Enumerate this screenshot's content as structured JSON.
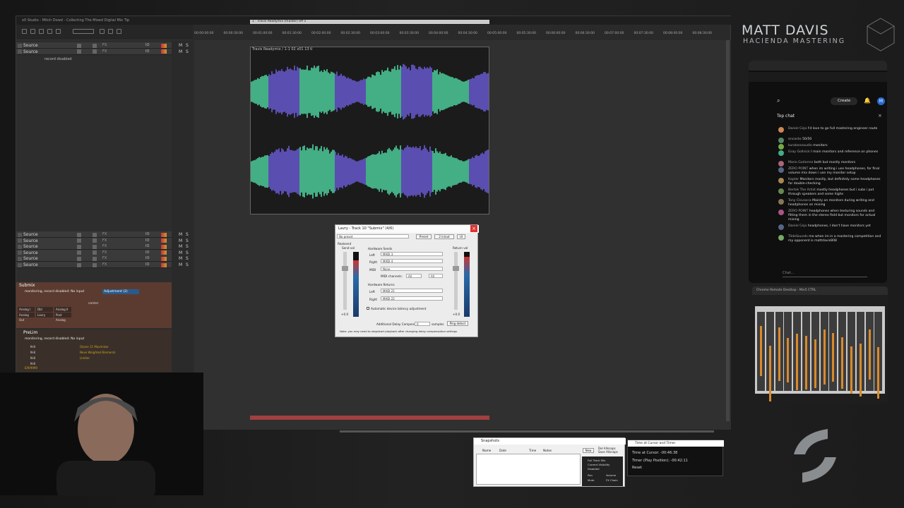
{
  "daw": {
    "window_title": "x0 Studio - Mitch Dowd - Collecting The Mixed Digital Mix Tip",
    "tracks_top": [
      {
        "name": "Source",
        "fx": "FX",
        "io": "IO"
      },
      {
        "name": "Source",
        "fx": "FX",
        "io": "IO"
      }
    ],
    "record_status_top": "record disabled",
    "tracks_mid": [
      {
        "name": "Source",
        "fx": "FX",
        "io": "IO"
      },
      {
        "name": "Source",
        "fx": "FX",
        "io": "IO"
      },
      {
        "name": "Source",
        "fx": "FX",
        "io": "IO"
      },
      {
        "name": "Source",
        "fx": "FX",
        "io": "IO"
      },
      {
        "name": "Source",
        "fx": "FX",
        "io": "IO"
      },
      {
        "name": "Source",
        "fx": "FX",
        "io": "IO"
      }
    ],
    "submix": {
      "name": "Submix",
      "status": "monitoring, record disabled: No input",
      "plugin": "Adjustment (2)",
      "sends": [
        "Analog I",
        "Dbl",
        "Analog II",
        "Analog Out",
        "Lavry",
        "Post Analog"
      ],
      "center": "center"
    },
    "prelim": {
      "name": "PreLim",
      "status": "monitoring, record disabled: No input",
      "inserts": [
        "Ozone 11 Maximizer",
        "Neve Weighted Elements",
        "Limiter"
      ],
      "nodes": [
        "N-8",
        "N-8",
        "N-8",
        "N-8"
      ],
      "cpu": "E/9/9999"
    },
    "item_label": "Travis Readymix / 1-1 02 x01 13 tl",
    "item_selection": "1 - Travis Readymix (master) eff 1",
    "ruler": [
      "00:00:00:00",
      "00:00:30:00",
      "00:01:00:00",
      "00:01:30:00",
      "00:02:00:00",
      "00:02:30:00",
      "00:03:00:00",
      "00:03:30:00",
      "00:04:00:00",
      "00:04:30:00",
      "00:05:00:00",
      "00:05:30:00",
      "00:06:00:00",
      "00:06:30:00",
      "00:07:00:00",
      "00:07:30:00",
      "00:08:00:00",
      "00:08:30:00"
    ],
    "mute_label": "M",
    "solo_label": "S"
  },
  "routing_dialog": {
    "title": "Lavry - Track 10 \"Submix\" (4/6)",
    "preset": "No preset",
    "preset_button": "Preset",
    "in_out": "2 in/out",
    "ui_button": "UI",
    "realsend": "Realsend",
    "send_vol": "Send vol",
    "return_vol": "Return vol",
    "hardware_sends": "Hardware Sends",
    "left": "Left",
    "right": "Right",
    "midi": "MIDI",
    "send_left": "MADI 3",
    "send_right": "MADI 4",
    "midi_value": "None",
    "midi_channels": "MIDI channels:",
    "all1": "All",
    "all2": "All",
    "hardware_returns": "Hardware Returns",
    "ret_left": "MADI 21",
    "ret_right": "MADI 22",
    "auto_latency": "Automatic device latency adjustment",
    "additional_delay": "Additional Delay Compensation:",
    "delay_value": "0",
    "samples": "samples",
    "ping_detect": "Ping detect",
    "note": "Note: you may need to stop/start playback after changing delay compensation settings",
    "send_db": "+0.0",
    "return_db": "+0.0"
  },
  "branding": {
    "line1": "MATT DAVIS",
    "line2": "HACIENDA MASTERING"
  },
  "chat": {
    "create_button": "Create",
    "header": "Top chat",
    "avatar_letter": "M",
    "input_placeholder": "Chat...",
    "messages": [
      {
        "user": "Daniel Ceja",
        "text": "I'd love to go full mastering engineer route"
      },
      {
        "user": "encanto",
        "text": "50/50"
      },
      {
        "user": "kurokonoaudio",
        "text": "monitors"
      },
      {
        "user": "Gray Gollnick",
        "text": "I main monitors and reference on phones"
      },
      {
        "user": "Mario Gutierrez",
        "text": "both but mostly monitors"
      },
      {
        "user": "ZERO POINT",
        "text": "when im writing i use headphones, for final volume mix down i use my monitor setup"
      },
      {
        "user": "Kapter",
        "text": "Monitors mostly, but definitely some headphones for double-checking"
      },
      {
        "user": "Bertok The Artist",
        "text": "mostly headphones but i subs i put through speakers and some highs"
      },
      {
        "user": "Tony Clovacca",
        "text": "Mainly on monitors during writing and headphones on mixing"
      },
      {
        "user": "ZERO POINT",
        "text": "headphones when texturing sounds and fitting them in the stereo field but monitors for actual mixing"
      },
      {
        "user": "Daniel Ceja",
        "text": "headphones, I don't have monitors yet"
      },
      {
        "user": "TildeSounds",
        "text": "me when im in a mastering competition and my opponent is mattdavis808"
      }
    ]
  },
  "remote": {
    "title": "Chrome Remote Desktop - Mix5 CTRL"
  },
  "snapshots": {
    "title": "Snapshots",
    "columns": [
      "Name",
      "Date",
      "Time",
      "Notes"
    ],
    "new_button": "New",
    "options": [
      "Full Track Mix",
      "Current Visibility",
      "Disabled"
    ],
    "checks": [
      "Pan",
      "Volume",
      "Mute",
      "FX Chain"
    ],
    "side_labels": [
      "Del Allsnaps",
      "Save Allsnaps"
    ]
  },
  "timer": {
    "title": "Time at Cursor and Timer",
    "cursor": "Time at Cursor: -00:46:38",
    "play": "Timer (Play Position): -00:42:11",
    "reset": "Reset"
  },
  "colors": {
    "accent": "#c9a227",
    "submix_bg": "#5b3b30",
    "wave_a": "#4fd3a0",
    "wave_b": "#6a5bd6"
  }
}
